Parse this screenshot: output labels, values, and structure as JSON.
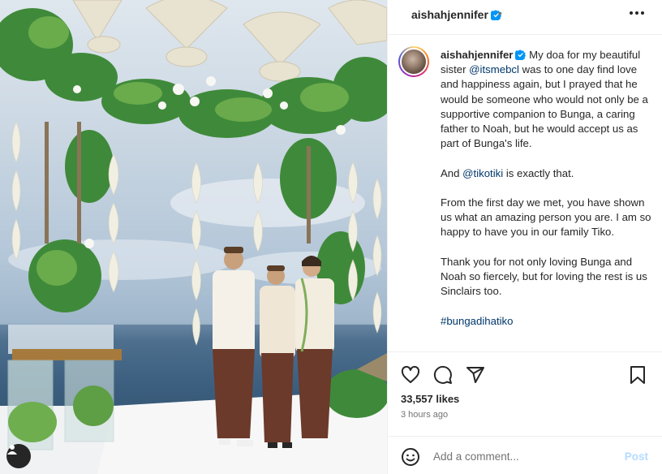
{
  "post": {
    "username": "aishahjennifer",
    "more_icon": "more-horizontal-icon",
    "verified_icon": "verified-badge-icon",
    "header_separator": "•"
  },
  "caption": {
    "author": "aishahjennifer",
    "segments": [
      {
        "type": "text",
        "text": "My doa for my beautiful sister "
      },
      {
        "type": "mention",
        "text": "@itsmebcl"
      },
      {
        "type": "text",
        "text": " was to one day find love and happiness again, but I prayed that he would be someone who would not only be a supportive companion to Bunga, a caring father to Noah, but he would accept us as part of Bunga's life.\n\nAnd "
      },
      {
        "type": "mention",
        "text": "@tikotiki"
      },
      {
        "type": "text",
        "text": " is exactly that.\n\nFrom the first day we met, you have shown us what an amazing person you are. I am so happy to have you in our family Tiko.\n\nThank you for not only loving Bunga and Noah so fiercely, but for loving the rest is us Sinclairs too.\n\n"
      },
      {
        "type": "hashtag",
        "text": "#bungadihatiko"
      }
    ]
  },
  "actions": {
    "icons": [
      "heart-icon",
      "comment-icon",
      "share-icon",
      "bookmark-icon"
    ],
    "likes": "33,557 likes",
    "time": "3 hours ago"
  },
  "comment_bar": {
    "emoji_icon": "emoji-icon",
    "placeholder": "Add a comment...",
    "post_label": "Post"
  },
  "colors": {
    "link": "#00376b",
    "verified": "#0095f6",
    "post_disabled": "#b3dbff",
    "muted": "#737373"
  }
}
